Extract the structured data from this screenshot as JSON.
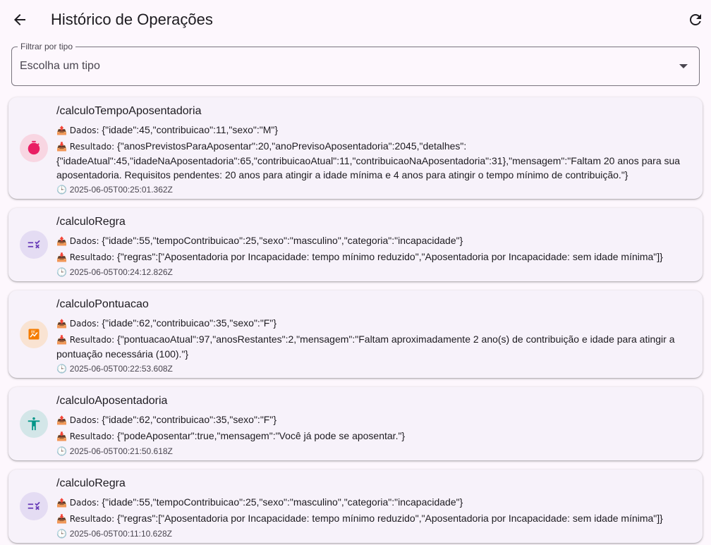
{
  "header": {
    "title": "Histórico de Operações",
    "back_icon": "arrow-back-icon",
    "refresh_icon": "refresh-icon"
  },
  "filter": {
    "label": "Filtrar por tipo",
    "placeholder": "Escolha um tipo"
  },
  "operations": [
    {
      "icon": "timer-icon",
      "icon_color": "#e91e63",
      "icon_bg": "#f8d6e2",
      "title": "/calculoTempoAposentadoria",
      "dados_prefix": "📤 Dados: ",
      "dados": "{\"idade\":45,\"contribuicao\":11,\"sexo\":\"M\"}",
      "resultado_prefix": "📥 Resultado: ",
      "resultado": "{\"anosPrevistosParaAposentar\":20,\"anoPrevisoAposentadoria\":2045,\"detalhes\": {\"idadeAtual\":45,\"idadeNaAposentadoria\":65,\"contribuicaoAtual\":11,\"contribuicaoNaAposentadoria\":31},\"mensagem\":\"Faltam 20 anos para sua aposentadoria. Requisitos pendentes: 20 anos para atingir a idade mínima e 4 anos para atingir o tempo mínimo de contribuição.\"}",
      "timestamp_prefix": "🕒 ",
      "timestamp": "2025-06-05T00:25:01.362Z"
    },
    {
      "icon": "rule-icon",
      "icon_color": "#673ab7",
      "icon_bg": "#e4dcf3",
      "title": "/calculoRegra",
      "dados_prefix": "📤 Dados: ",
      "dados": "{\"idade\":55,\"tempoContribuicao\":25,\"sexo\":\"masculino\",\"categoria\":\"incapacidade\"}",
      "resultado_prefix": "📥 Resultado: ",
      "resultado": "{\"regras\":[\"Aposentadoria por Incapacidade: tempo mínimo reduzido\",\"Aposentadoria por Incapacidade: sem idade mínima\"]}",
      "timestamp_prefix": "🕒 ",
      "timestamp": "2025-06-05T00:24:12.826Z"
    },
    {
      "icon": "score-icon",
      "icon_color": "#f57c00",
      "icon_bg": "#f9e3d2",
      "title": "/calculoPontuacao",
      "dados_prefix": "📤 Dados: ",
      "dados": "{\"idade\":62,\"contribuicao\":35,\"sexo\":\"F\"}",
      "resultado_prefix": "📥 Resultado: ",
      "resultado": "{\"pontuacaoAtual\":97,\"anosRestantes\":2,\"mensagem\":\"Faltam aproximadamente 2 ano(s) de contribuição e idade para atingir a pontuação necessária (100).\"}",
      "timestamp_prefix": "🕒 ",
      "timestamp": "2025-06-05T00:22:53.608Z"
    },
    {
      "icon": "accessibility-icon",
      "icon_color": "#009688",
      "icon_bg": "#d3e6e8",
      "title": "/calculoAposentadoria",
      "dados_prefix": "📤 Dados: ",
      "dados": "{\"idade\":62,\"contribuicao\":35,\"sexo\":\"F\"}",
      "resultado_prefix": "📥 Resultado: ",
      "resultado": "{\"podeAposentar\":true,\"mensagem\":\"Você já pode se aposentar.\"}",
      "timestamp_prefix": "🕒 ",
      "timestamp": "2025-06-05T00:21:50.618Z"
    },
    {
      "icon": "rule-icon",
      "icon_color": "#673ab7",
      "icon_bg": "#e4dcf3",
      "title": "/calculoRegra",
      "dados_prefix": "📤 Dados: ",
      "dados": "{\"idade\":55,\"tempoContribuicao\":25,\"sexo\":\"masculino\",\"categoria\":\"incapacidade\"}",
      "resultado_prefix": "📥 Resultado: ",
      "resultado": "{\"regras\":[\"Aposentadoria por Incapacidade: tempo mínimo reduzido\",\"Aposentadoria por Incapacidade: sem idade mínima\"]}",
      "timestamp_prefix": "🕒 ",
      "timestamp": "2025-06-05T00:11:10.628Z"
    }
  ]
}
